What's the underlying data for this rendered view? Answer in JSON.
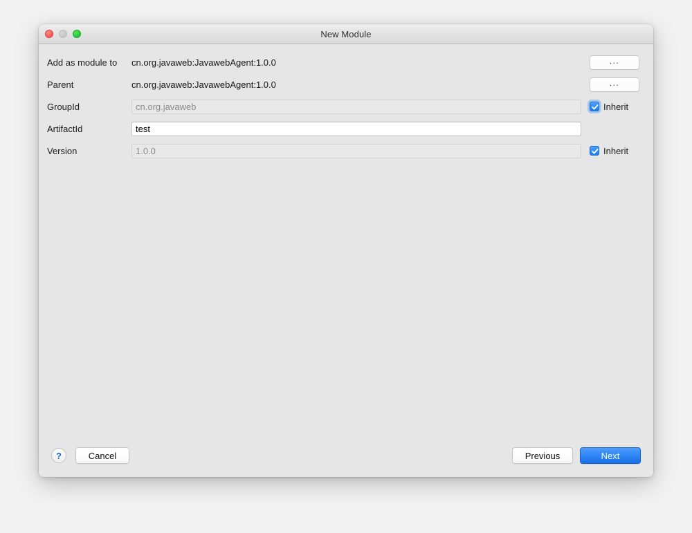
{
  "window": {
    "title": "New Module",
    "traffic_lights": [
      {
        "name": "close-button",
        "color": "#fc5f57"
      },
      {
        "name": "minimize-button",
        "color": "#c8c8c8"
      },
      {
        "name": "zoom-button",
        "color": "#27c93f"
      }
    ]
  },
  "form": {
    "rows": [
      {
        "label": "Add as module to",
        "type": "static",
        "value": "cn.org.javaweb:JavawebAgent:1.0.0",
        "trailing": "button",
        "button_label": "..."
      },
      {
        "label": "Parent",
        "type": "static",
        "value": "cn.org.javaweb:JavawebAgent:1.0.0",
        "trailing": "button",
        "button_label": "..."
      },
      {
        "label": "GroupId",
        "type": "input",
        "value": "cn.org.javaweb",
        "placeholder": "",
        "enabled": false,
        "trailing": "checkbox",
        "checkbox_label": "Inherit",
        "checked": true,
        "focused": true
      },
      {
        "label": "ArtifactId",
        "type": "input",
        "value": "test",
        "placeholder": "",
        "enabled": true,
        "trailing": "none"
      },
      {
        "label": "Version",
        "type": "input",
        "value": "1.0.0",
        "placeholder": "",
        "enabled": false,
        "trailing": "checkbox",
        "checkbox_label": "Inherit",
        "checked": true,
        "focused": false
      }
    ]
  },
  "footer": {
    "help_label": "?",
    "cancel_label": "Cancel",
    "previous_label": "Previous",
    "next_label": "Next"
  },
  "colors": {
    "accent_blue": "#2f87f7",
    "checkbox_blue": "#1b7df5",
    "help_blue": "#1565e8",
    "window_bg": "#e6e6e6",
    "titlebar_bg": "#e3e3e3",
    "desktop_bg": "#f2f2f2",
    "disabled_field_bg": "#e8e8e8",
    "disabled_text": "#8b8b8b"
  }
}
